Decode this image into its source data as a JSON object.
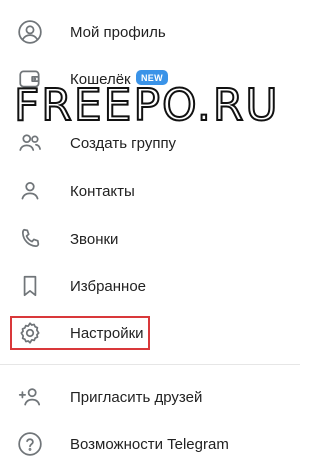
{
  "menu": {
    "items": [
      {
        "label": "Мой профиль",
        "icon": "profile-icon"
      },
      {
        "label": "Кошелёк",
        "icon": "wallet-icon",
        "badge": "NEW"
      },
      {
        "label": "Создать группу",
        "icon": "group-icon"
      },
      {
        "label": "Контакты",
        "icon": "contacts-icon"
      },
      {
        "label": "Звонки",
        "icon": "phone-icon"
      },
      {
        "label": "Избранное",
        "icon": "bookmark-icon"
      },
      {
        "label": "Настройки",
        "icon": "settings-icon"
      },
      {
        "label": "Пригласить друзей",
        "icon": "add-user-icon"
      },
      {
        "label": "Возможности Telegram",
        "icon": "help-icon"
      }
    ]
  },
  "watermark": "FREEPO.RU",
  "colors": {
    "icon": "#707579",
    "badge": "#3a93e8",
    "highlight": "#d9383a"
  }
}
